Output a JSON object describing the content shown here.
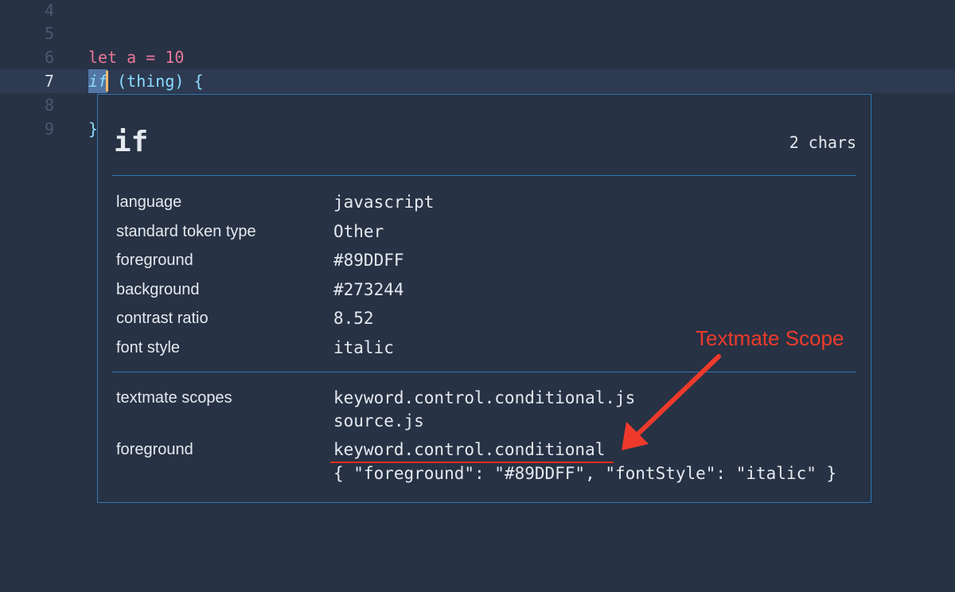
{
  "editor": {
    "lines": [
      {
        "number": "4"
      },
      {
        "number": "5"
      },
      {
        "number": "6",
        "tokens": [
          "let",
          "a",
          "=",
          "10"
        ]
      },
      {
        "number": "7",
        "tokens": [
          "if",
          "(thing)",
          "{"
        ]
      },
      {
        "number": "8"
      },
      {
        "number": "9",
        "tokens": [
          "}"
        ]
      }
    ]
  },
  "inspector": {
    "token": "if",
    "length": "2 chars",
    "properties": [
      {
        "label": "language",
        "value": "javascript"
      },
      {
        "label": "standard token type",
        "value": "Other"
      },
      {
        "label": "foreground",
        "value": "#89DDFF"
      },
      {
        "label": "background",
        "value": "#273244"
      },
      {
        "label": "contrast ratio",
        "value": "8.52"
      },
      {
        "label": "font style",
        "value": "italic"
      }
    ],
    "textmate": {
      "scopes_label": "textmate scopes",
      "scopes": [
        "keyword.control.conditional.js",
        "source.js"
      ],
      "foreground_label": "foreground",
      "rule": "keyword.control.conditional",
      "rule_style": "{ \"foreground\": \"#89DDFF\", \"fontStyle\": \"italic\" }"
    }
  },
  "annotation": {
    "text": "Textmate Scope"
  },
  "colors": {
    "background": "#273244",
    "accent_border": "#2f78b7",
    "keyword": "#89DDFF",
    "annotation_red": "#ef3a2b"
  }
}
